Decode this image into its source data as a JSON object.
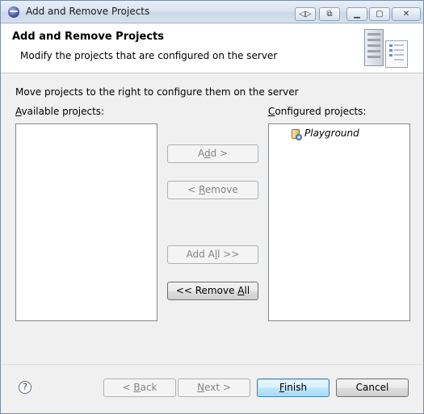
{
  "window": {
    "title": "Add and Remove Projects",
    "controls": {
      "restore": "◁▷",
      "float": "⧉",
      "minimize": "▁",
      "maximize": "▢",
      "close": "✕"
    }
  },
  "banner": {
    "title": "Add and Remove Projects",
    "description": "Modify the projects that are configured on the server",
    "graphic_icon": "server-icon"
  },
  "instruction": "Move projects to the right to configure them on the server",
  "available": {
    "label_mnemonic": "A",
    "label_rest": "vailable projects:",
    "items": []
  },
  "configured": {
    "label_mnemonic": "C",
    "label_rest": "onfigured projects:",
    "items": [
      {
        "label": "Playground",
        "icon": "project-icon"
      }
    ]
  },
  "transfer_buttons": {
    "add": {
      "pre": "A",
      "mn": "d",
      "post": "d >"
    },
    "remove": {
      "pre": "< ",
      "mn": "R",
      "post": "emove"
    },
    "add_all": {
      "pre": "Add A",
      "mn": "l",
      "post": "l >>"
    },
    "remove_all": {
      "pre": "<< Remove ",
      "mn": "A",
      "post": "ll"
    }
  },
  "footer": {
    "help": "?",
    "back": {
      "pre": "< ",
      "mn": "B",
      "post": "ack"
    },
    "next": {
      "pre": "",
      "mn": "N",
      "post": "ext >"
    },
    "finish": {
      "pre": "",
      "mn": "F",
      "post": "inish"
    },
    "cancel": "Cancel"
  },
  "colors": {
    "default_button": "#3c7fb1",
    "disabled_text": "#838383"
  }
}
